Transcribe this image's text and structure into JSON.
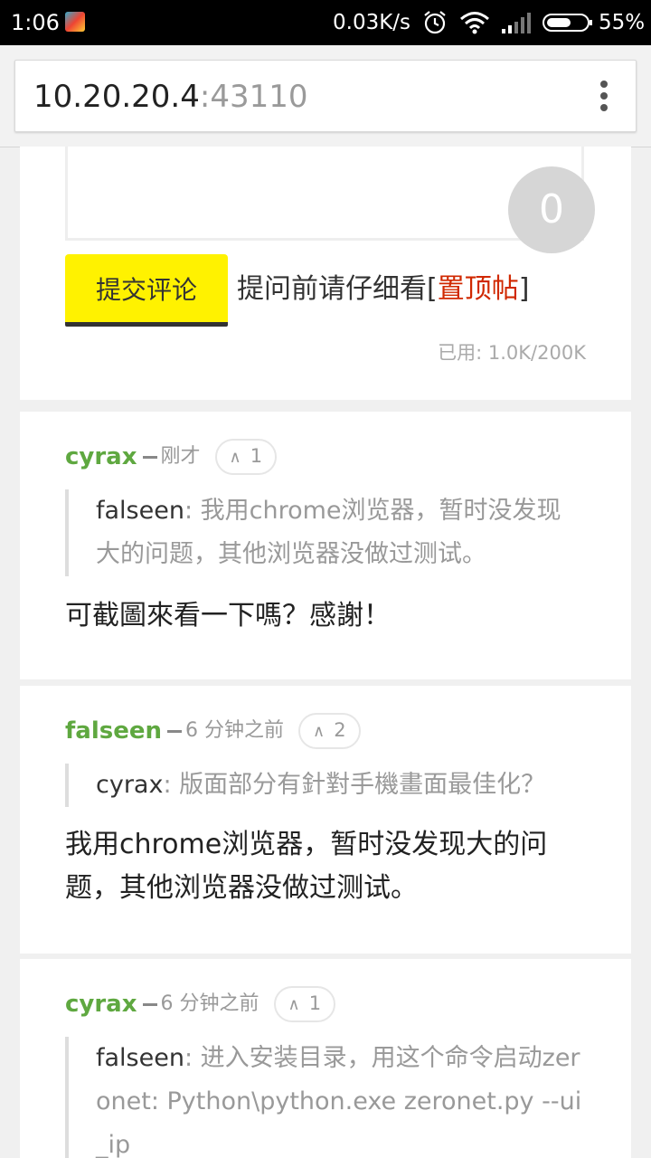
{
  "status_bar": {
    "time": "1:06",
    "net_speed": "0.03K/s",
    "battery": "55%",
    "icons": [
      "app-icon",
      "alarm-icon",
      "wifi-icon",
      "signal-icon",
      "battery-icon"
    ]
  },
  "browser": {
    "url_host": "10.20.20.4",
    "url_port": ":43110"
  },
  "composer": {
    "counter": "0",
    "submit_label": "提交评论",
    "notice_prefix": "提问前请仔细看[",
    "notice_link": "置顶帖",
    "notice_suffix": "]",
    "usage": "已用: 1.0K/200K"
  },
  "comments": [
    {
      "user": "cyrax",
      "time": "刚才",
      "votes": "1",
      "quote_user": "falseen",
      "quote_text": ": 我用chrome浏览器，暂时没发现大的问题，其他浏览器没做过测试。",
      "body": "可截圖來看一下嗎？感謝！"
    },
    {
      "user": "falseen",
      "time": "6 分钟之前",
      "votes": "2",
      "quote_user": "cyrax",
      "quote_text": ": 版面部分有針對手機畫面最佳化？",
      "body": "我用chrome浏览器，暂时没发现大的问题，其他浏览器没做过测试。"
    },
    {
      "user": "cyrax",
      "time": "6 分钟之前",
      "votes": "1",
      "quote_user": "falseen",
      "quote_text": ": 进入安装目录，用这个命令启动zeronet: Python\\python.exe zeronet.py --ui_ip",
      "body": ""
    }
  ],
  "colors": {
    "username": "#5fa840",
    "button": "#fff200",
    "link": "#d02800"
  }
}
